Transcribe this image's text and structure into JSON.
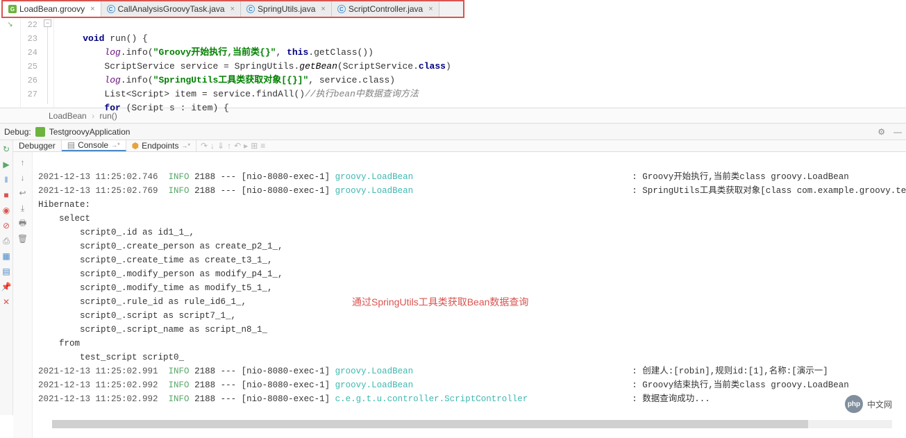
{
  "tabs": [
    {
      "name": "LoadBean.groovy",
      "icon": "G",
      "active": true
    },
    {
      "name": "CallAnalysisGroovyTask.java",
      "icon": "C",
      "active": false
    },
    {
      "name": "SpringUtils.java",
      "icon": "C",
      "active": false
    },
    {
      "name": "ScriptController.java",
      "icon": "C",
      "active": false
    }
  ],
  "gutter": {
    "start": 22,
    "end": 27
  },
  "code": {
    "l22": {
      "kw": "void",
      "name": "run",
      "paren": "() {"
    },
    "l23": {
      "fld": "log",
      "mtd": ".info(",
      "str": "\"Groovy开始执行,当前类{}\"",
      "rest": ", ",
      "kw2": "this",
      "call": ".getClass())"
    },
    "l24": {
      "p1": "ScriptService service = SpringUtils.",
      "mtd": "getBean",
      "p2": "(ScriptService.",
      "kw": "class",
      "p3": ")"
    },
    "l25": {
      "fld": "log",
      "mtd": ".info(",
      "str": "\"SpringUtils工具类获取对象[{}]\"",
      "rest": ", service.class)"
    },
    "l26": {
      "p1": "List<Script> item = service.findAll()",
      "cmt": "//执行bean中数据查询方法"
    },
    "l27": {
      "kw": "for",
      "rest": " (Script s : item) {"
    }
  },
  "breadcrumb": {
    "a": "LoadBean",
    "b": "run()"
  },
  "debug": {
    "label": "Debug:",
    "config": "TestgroovyApplication",
    "tabs": {
      "debugger": "Debugger",
      "console": "Console",
      "endpoints": "Endpoints"
    }
  },
  "console_lines": [
    {
      "ts": "2021-12-13 11:25:02.746",
      "lvl": "INFO",
      "pid": "2188",
      "thr": "[nio-8080-exec-1]",
      "lg": "groovy.LoadBean",
      "msg": "Groovy开始执行,当前类class groovy.LoadBean"
    },
    {
      "ts": "2021-12-13 11:25:02.769",
      "lvl": "INFO",
      "pid": "2188",
      "thr": "[nio-8080-exec-1]",
      "lg": "groovy.LoadBean",
      "msg": "SpringUtils工具类获取对象[class com.example.groovy.testg"
    }
  ],
  "sql": [
    "Hibernate:",
    "    select",
    "        script0_.id as id1_1_,",
    "        script0_.create_person as create_p2_1_,",
    "        script0_.create_time as create_t3_1_,",
    "        script0_.modify_person as modify_p4_1_,",
    "        script0_.modify_time as modify_t5_1_,",
    "        script0_.rule_id as rule_id6_1_,",
    "        script0_.script as script7_1_,",
    "        script0_.script_name as script_n8_1_",
    "    from",
    "        test_script script0_"
  ],
  "console_lines2": [
    {
      "ts": "2021-12-13 11:25:02.991",
      "lvl": "INFO",
      "pid": "2188",
      "thr": "[nio-8080-exec-1]",
      "lg": "groovy.LoadBean",
      "msg": "创建人:[robin],规则id:[1],名称:[演示一]"
    },
    {
      "ts": "2021-12-13 11:25:02.992",
      "lvl": "INFO",
      "pid": "2188",
      "thr": "[nio-8080-exec-1]",
      "lg": "groovy.LoadBean",
      "msg": "Groovy结束执行,当前类class groovy.LoadBean"
    },
    {
      "ts": "2021-12-13 11:25:02.992",
      "lvl": "INFO",
      "pid": "2188",
      "thr": "[nio-8080-exec-1]",
      "lg": "c.e.g.t.u.controller.ScriptController",
      "msg": "数据查询成功..."
    }
  ],
  "annotation": "通过SpringUtils工具类获取Bean数据查询",
  "watermark": {
    "logo": "php",
    "text": "中文网"
  }
}
